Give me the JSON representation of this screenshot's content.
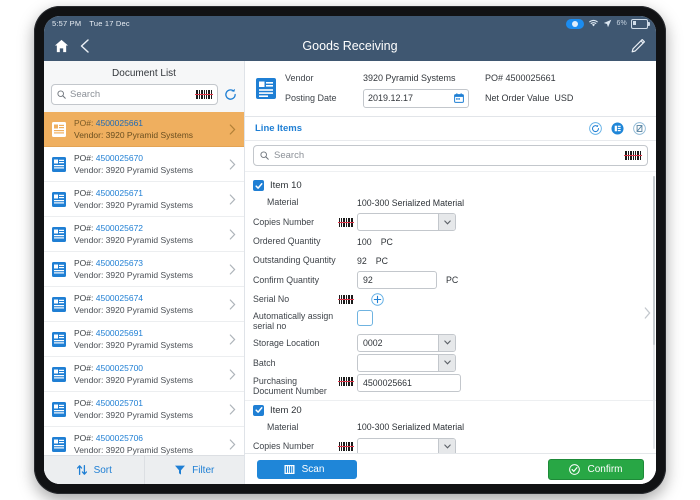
{
  "status_bar": {
    "time": "5:57 PM",
    "date": "Tue 17 Dec",
    "battery_pct": "6%",
    "icons": [
      "bluetooth-pill-icon",
      "wifi-icon",
      "location-arrow-icon",
      "battery-icon"
    ]
  },
  "app_header": {
    "title": "Goods Receiving",
    "home_icon": "home-icon",
    "back_icon": "back-chevron-icon",
    "edit_icon": "pencil-edit-icon"
  },
  "colors": {
    "header_bg": "#3f5771",
    "accent_blue": "#1f7fd4",
    "selected_row": "#efaf5f",
    "confirm_green": "#28a745",
    "scan_blue": "#1f86d8",
    "barcode_red": "#e2384c"
  },
  "left_panel": {
    "title": "Document List",
    "search": {
      "placeholder": "Search",
      "icon": "magnifier-icon",
      "barcode_icon": "barcode-icon"
    },
    "refresh_icon": "refresh-icon",
    "documents": [
      {
        "po_label": "PO#:",
        "po_number": "4500025661",
        "vendor": "Vendor: 3920 Pyramid Systems",
        "selected": true
      },
      {
        "po_label": "PO#:",
        "po_number": "4500025670",
        "vendor": "Vendor: 3920 Pyramid Systems",
        "selected": false
      },
      {
        "po_label": "PO#:",
        "po_number": "4500025671",
        "vendor": "Vendor: 3920 Pyramid Systems",
        "selected": false
      },
      {
        "po_label": "PO#:",
        "po_number": "4500025672",
        "vendor": "Vendor: 3920 Pyramid Systems",
        "selected": false
      },
      {
        "po_label": "PO#:",
        "po_number": "4500025673",
        "vendor": "Vendor: 3920 Pyramid Systems",
        "selected": false
      },
      {
        "po_label": "PO#:",
        "po_number": "4500025674",
        "vendor": "Vendor: 3920 Pyramid Systems",
        "selected": false
      },
      {
        "po_label": "PO#:",
        "po_number": "4500025691",
        "vendor": "Vendor: 3920 Pyramid Systems",
        "selected": false
      },
      {
        "po_label": "PO#:",
        "po_number": "4500025700",
        "vendor": "Vendor: 3920 Pyramid Systems",
        "selected": false
      },
      {
        "po_label": "PO#:",
        "po_number": "4500025701",
        "vendor": "Vendor: 3920 Pyramid Systems",
        "selected": false
      },
      {
        "po_label": "PO#:",
        "po_number": "4500025706",
        "vendor": "Vendor: 3920 Pyramid Systems",
        "selected": false
      }
    ],
    "footer": {
      "sort_label": "Sort",
      "filter_label": "Filter",
      "sort_icon": "sort-arrows-icon",
      "filter_icon": "funnel-icon"
    }
  },
  "header_panel": {
    "doc_icon": "document-icon",
    "vendor_label": "Vendor",
    "vendor_value": "3920 Pyramid Systems",
    "po_label": "PO#",
    "po_value": "4500025661",
    "posting_date_label": "Posting Date",
    "posting_date_value": "2019.12.17",
    "calendar_icon": "calendar-icon",
    "net_order_value_label": "Net Order Value",
    "currency": "USD"
  },
  "line_items": {
    "title": "Line Items",
    "actions": [
      {
        "name": "refresh-circle-icon"
      },
      {
        "name": "list-circle-icon"
      },
      {
        "name": "document-disabled-circle-icon"
      }
    ],
    "search": {
      "placeholder": "Search",
      "icon": "magnifier-icon",
      "barcode_icon": "barcode-icon"
    },
    "items": [
      {
        "title": "Item 10",
        "checked": true,
        "fields": [
          {
            "type": "static",
            "label": "Material",
            "indent": true,
            "value": "100-300 Serialized Material"
          },
          {
            "type": "select",
            "label": "Copies Number",
            "barcode": true,
            "value": ""
          },
          {
            "type": "static",
            "label": "Ordered Quantity",
            "value": "100",
            "unit": "PC"
          },
          {
            "type": "static",
            "label": "Outstanding Quantity",
            "value": "92",
            "unit": "PC"
          },
          {
            "type": "text",
            "label": "Confirm Quantity",
            "value": "92",
            "unit": "PC"
          },
          {
            "type": "serial",
            "label": "Serial No",
            "barcode": true,
            "plus_icon": "plus-circle-icon"
          },
          {
            "type": "checkbox",
            "label": "Automatically assign serial no",
            "checked": false
          },
          {
            "type": "select",
            "label": "Storage Location",
            "value": "0002"
          },
          {
            "type": "select",
            "label": "Batch",
            "value": ""
          },
          {
            "type": "text",
            "label": "Purchasing Document Number",
            "barcode": true,
            "value": "4500025661",
            "wide": true
          }
        ]
      },
      {
        "title": "Item 20",
        "checked": true,
        "fields": [
          {
            "type": "static",
            "label": "Material",
            "indent": true,
            "value": "100-300 Serialized Material"
          },
          {
            "type": "select",
            "label": "Copies Number",
            "barcode": true,
            "value": ""
          }
        ]
      }
    ],
    "side_chevron_icon": "right-chevron-icon"
  },
  "action_bar": {
    "scan_label": "Scan",
    "scan_icon": "barcode-scan-icon",
    "confirm_label": "Confirm",
    "confirm_icon": "check-circle-icon"
  }
}
